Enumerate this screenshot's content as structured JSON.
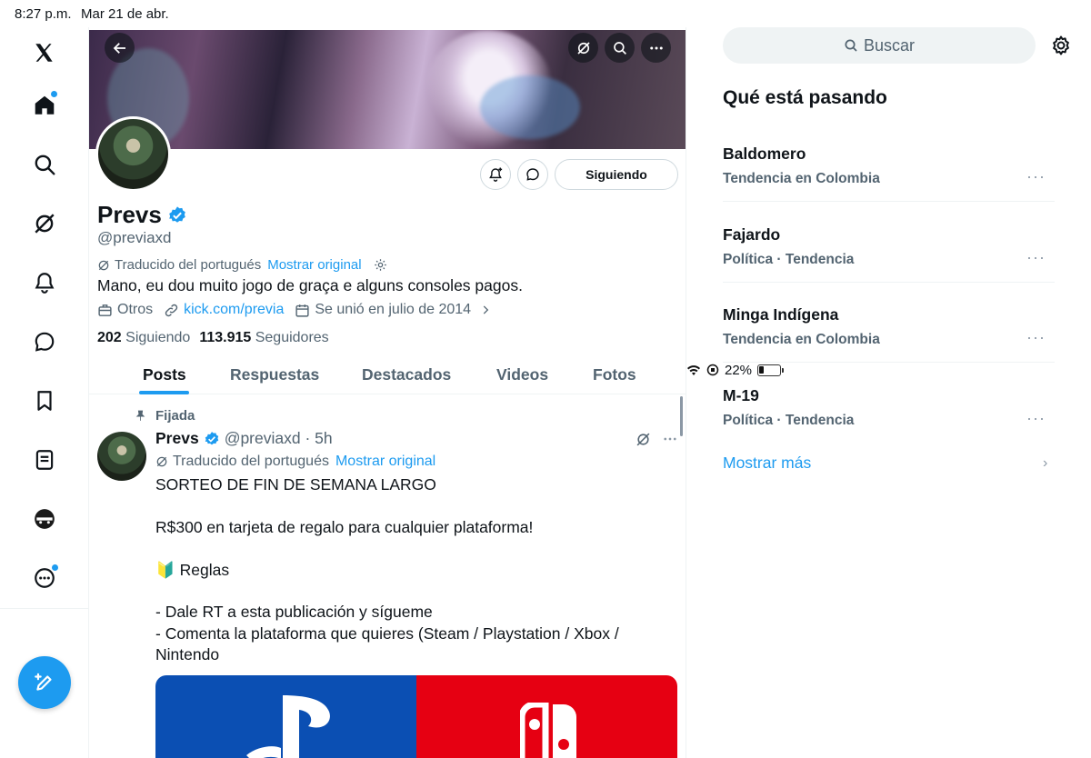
{
  "status_bar": {
    "time": "8:27 p.m.",
    "date": "Mar 21 de abr.",
    "battery": "22%"
  },
  "nav": {
    "items": [
      "x-logo",
      "home-icon",
      "search-icon",
      "grok-icon",
      "notifications-icon",
      "messages-icon",
      "bookmarks-icon",
      "lists-icon",
      "profile-icon",
      "more-icon"
    ],
    "compose_icon": "compose-icon"
  },
  "profile": {
    "name": "Prevs",
    "handle": "@previaxd",
    "translated_label": "Traducido del portugués",
    "show_original": "Mostrar original",
    "bio": "Mano, eu dou muito jogo de graça e alguns consoles pagos.",
    "category": "Otros",
    "link": "kick.com/previa",
    "joined": "Se unió en julio de 2014",
    "following_count": "202",
    "following_label": "Siguiendo",
    "followers_count": "113.915",
    "followers_label": "Seguidores",
    "follow_button": "Siguiendo"
  },
  "tabs": [
    "Posts",
    "Respuestas",
    "Destacados",
    "Videos",
    "Fotos"
  ],
  "post": {
    "pinned_label": "Fijada",
    "author": "Prevs",
    "handle_time": "@previaxd · 5h",
    "translated_label": "Traducido del portugués",
    "show_original": "Mostrar original",
    "lines": [
      "SORTEO DE FIN DE SEMANA LARGO",
      "",
      "R$300 en tarjeta de regalo para cualquier plataforma!",
      "",
      "🔰 Reglas",
      "",
      "- Dale RT a esta publicación y sígueme",
      "- Comenta la plataforma que quieres (Steam / Playstation / Xbox /",
      "Nintendo"
    ]
  },
  "sidebar": {
    "search_placeholder": "Buscar",
    "trends_title": "Qué está pasando",
    "trends": [
      {
        "name": "Baldomero",
        "context": "Tendencia en Colombia"
      },
      {
        "name": "Fajardo",
        "context": "Política · Tendencia"
      },
      {
        "name": "Minga Indígena",
        "context": "Tendencia en Colombia"
      },
      {
        "name": "M-19",
        "context": "Política · Tendencia"
      }
    ],
    "show_more": "Mostrar más"
  },
  "colors": {
    "accent": "#1d9bf0",
    "text": "#0f1419",
    "muted": "#536471",
    "border": "#eff3f4"
  }
}
